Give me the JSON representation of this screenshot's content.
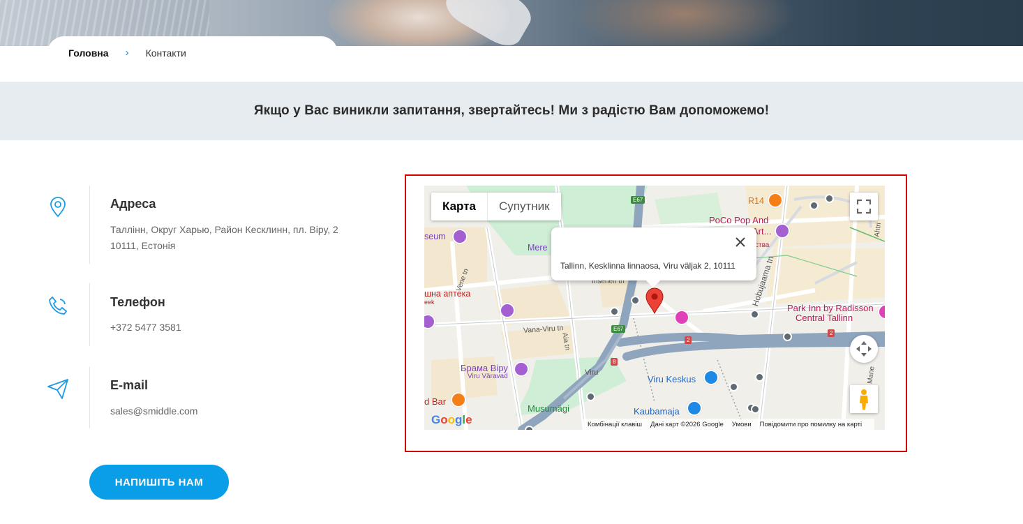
{
  "breadcrumb": {
    "home": "Головна",
    "separator": "›",
    "current": "Контакти"
  },
  "banner": {
    "text": "Якщо у Вас виникли запитання, звертайтесь! Ми з радістю Вам допоможемо!"
  },
  "contacts": [
    {
      "icon": "location-pin-icon",
      "title": "Адреса",
      "lines": [
        "Таллінн, Округ Харью, Район Кесклинн, пл. Віру, 2",
        "10111, Естонія"
      ]
    },
    {
      "icon": "phone-icon",
      "title": "Телефон",
      "lines": [
        "+372 5477 3581"
      ]
    },
    {
      "icon": "paper-plane-icon",
      "title": "E-mail",
      "lines": [
        "sales@smiddle.com"
      ]
    }
  ],
  "cta": {
    "label": "НАПИШІТЬ НАМ"
  },
  "map": {
    "type_map": "Карта",
    "type_satellite": "Супутник",
    "popup_address": "Tallinn, Kesklinna linnaosa, Viru väljak 2, 10111",
    "labels": {
      "poco": "PoCo Pop And",
      "art": "Art...",
      "r14": "R14",
      "museum": "seum",
      "mere": "Mere",
      "apteka": "шна аптека",
      "eek": "eek",
      "vene": "Vene tn",
      "inseneri": "Inseneri tn",
      "vanaviru": "Vana-Viru tn",
      "aia": "Aia tn",
      "hobujaama": "Hobujaama tn",
      "park_inn_1": "Park Inn by Radisson",
      "park_inn_2": "Central Tallinn",
      "viru_gate": "Брама Віру",
      "viru_varavad": "Viru Väravad",
      "viru_street": "Viru",
      "viru_keskus": "Viru Keskus",
      "bar": "d Bar",
      "musumagi": "Musumägi",
      "kaubamaja": "Kaubamaja",
      "ahtri": "Ahtri",
      "mane": "Mane",
      "ctva": "ства",
      "e67a": "E67",
      "e67b": "E67",
      "r2a": "2",
      "r2b": "2",
      "r8": "8"
    },
    "google": "Google",
    "attribution": [
      "Комбінації клавіш",
      "Дані карт ©2026 Google",
      "Умови",
      "Повідомити про помилку на карті"
    ]
  },
  "colors": {
    "accent": "#0a9ee8",
    "banner_bg": "#e6ecef",
    "highlight": "#d40000"
  }
}
